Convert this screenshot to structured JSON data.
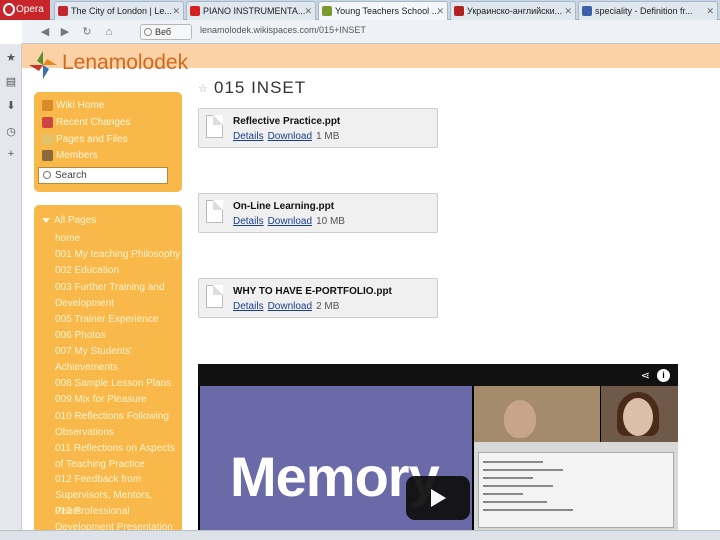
{
  "browser": {
    "menu_label": "Opera",
    "tabs": [
      {
        "label": "The City of London | Le...",
        "icon": "red-shield-icon",
        "color": "#c0282d"
      },
      {
        "label": "PIANO INSTRUMENTA...",
        "icon": "youtube-icon",
        "color": "#d61f1f"
      },
      {
        "label": "Young Teachers School ...",
        "icon": "wikispaces-icon",
        "color": "#7a9a2f"
      },
      {
        "label": "Украинско-английски...",
        "icon": "dictionary-icon",
        "color": "#b22222"
      },
      {
        "label": "speciality - Definition fr...",
        "icon": "definition-icon",
        "color": "#3b5fa8"
      }
    ],
    "view_button": "Веб",
    "url": "lenamolodek.wikispaces.com/015+INSET"
  },
  "site": {
    "brand": "Lenamolodek",
    "nav": [
      {
        "label": "Wiki Home",
        "icon": "home-icon"
      },
      {
        "label": "Recent Changes",
        "icon": "calendar-icon"
      },
      {
        "label": "Pages and Files",
        "icon": "pages-icon"
      },
      {
        "label": "Members",
        "icon": "members-icon"
      }
    ],
    "search_placeholder": "Search",
    "all_pages_label": "All Pages",
    "pages": [
      "home",
      "001 My teaching Philosophy",
      "002 Education",
      "003 Further Training and Development",
      "005 Trainer Experience",
      "006 Photos",
      "007 My Students' Achievements",
      "008 Sample Lesson Plans",
      "009 Mix for Pleasure",
      "010 Reflections Following Observations",
      "011 Reflections on Aspects of Teaching Practice",
      "012 Feedback from Supervisors, Mentors, Peers",
      "013 Professional Development Presentation"
    ]
  },
  "page": {
    "title": "015 INSET",
    "files": [
      {
        "name": "Reflective Practice.ppt",
        "details": "Details",
        "download": "Download",
        "size": "1 MB"
      },
      {
        "name": "On-Line Learning.ppt",
        "details": "Details",
        "download": "Download",
        "size": "10 MB"
      },
      {
        "name": "WHY TO HAVE E-PORTFOLIO.ppt",
        "details": "Details",
        "download": "Download",
        "size": "2 MB"
      }
    ],
    "video": {
      "slide_text": "Memory"
    }
  },
  "colors": {
    "panel": "#f8b84a",
    "header_band": "#fbd2a6",
    "brand": "#d2691e",
    "link": "#1a3d8f"
  }
}
